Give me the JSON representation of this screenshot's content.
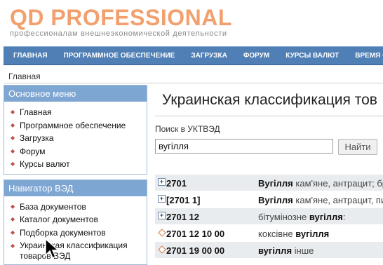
{
  "brand": {
    "title": "QD PROFESSIONAL",
    "subtitle": "профессионалам внешнеэкономической деятельности"
  },
  "nav": {
    "items": [
      "ГЛАВНАЯ",
      "ПРОГРАММНОЕ ОБЕСПЕЧЕНИЕ",
      "ЗАГРУЗКА",
      "ФОРУМ",
      "КУРСЫ ВАЛЮТ",
      "ВРЕМЯ ОЖИДАНИЯ"
    ]
  },
  "breadcrumb": "Главная",
  "sidebar": {
    "main_menu": {
      "title": "Основное меню",
      "items": [
        "Главная",
        "Программное обеспечение",
        "Загрузка",
        "Форум",
        "Курсы валют"
      ]
    },
    "ved_nav": {
      "title": "Навигатор ВЭД",
      "items": [
        "База документов",
        "Каталог документов",
        "Подборка документов",
        "Украинская классификация",
        "товаров ВЭД"
      ]
    }
  },
  "main": {
    "title": "Украинская классификация тов",
    "search_label": "Поиск в УКТВЭД",
    "search_value": "вугілля",
    "search_button": "Найти",
    "rows": [
      {
        "icon": "plus-box-icon",
        "code": "2701",
        "pre": "",
        "bold": "Вугілля",
        "post": " кам'яне, антрацит; бр"
      },
      {
        "icon": "plus-box-icon",
        "code": "[2701 1]",
        "pre": "",
        "bold": "Вугілля",
        "post": " кам'яне, антрацит, пи"
      },
      {
        "icon": "plus-box-icon",
        "code": "2701 12",
        "pre": "бітумінозне ",
        "bold": "вугілля",
        "post": ":"
      },
      {
        "icon": "diamond-icon",
        "code": "2701 12 10 00",
        "pre": "коксівне ",
        "bold": "вугілля",
        "post": ""
      },
      {
        "icon": "diamond-icon",
        "code": "2701 19 00 00",
        "pre": "",
        "bold": "вугілля",
        "post": " інше"
      }
    ]
  },
  "colors": {
    "brand_orange": "#f2a06e",
    "nav_blue": "#4f7fb5",
    "panel_header": "#7ea6d3",
    "row_shade": "#e9ecef"
  }
}
